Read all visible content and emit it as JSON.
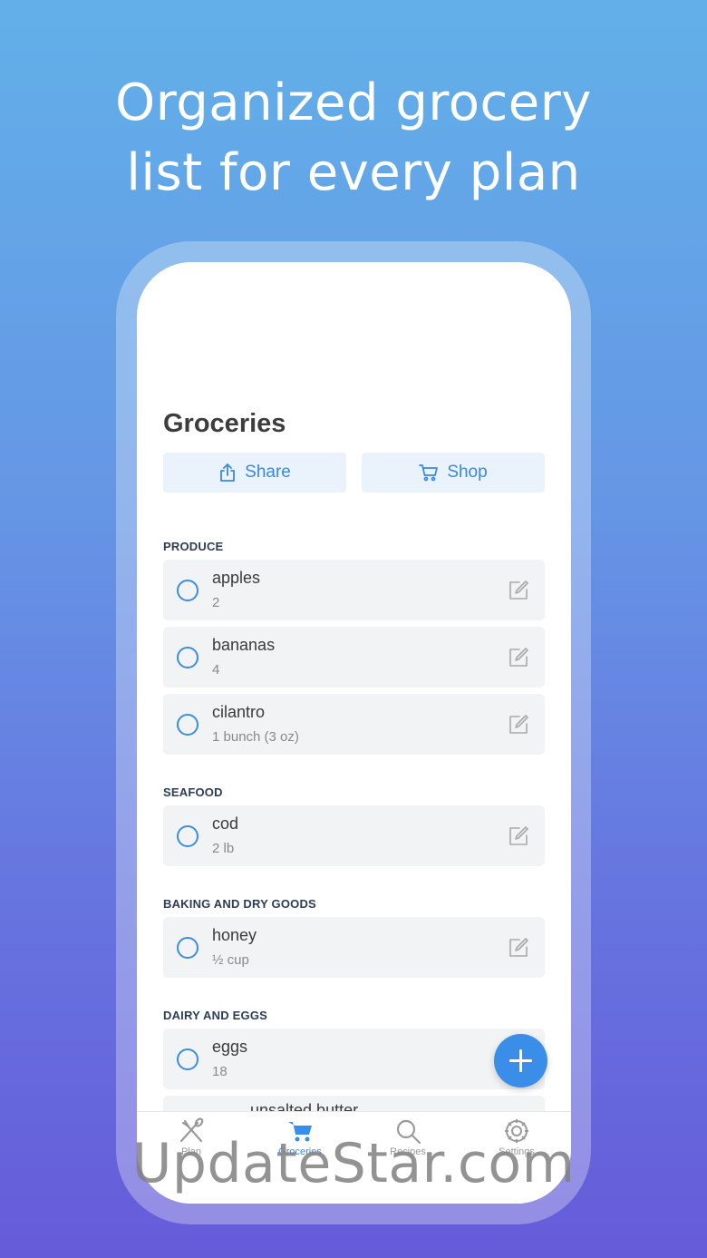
{
  "headline": {
    "line1": "Organized grocery",
    "line2": "list for every plan"
  },
  "screen": {
    "title": "Groceries",
    "actions": {
      "share_label": "Share",
      "shop_label": "Shop",
      "share_icon": "share-icon",
      "shop_icon": "cart-icon"
    },
    "sections": [
      {
        "label": "PRODUCE",
        "items": [
          {
            "name": "apples",
            "qty": "2"
          },
          {
            "name": "bananas",
            "qty": "4"
          },
          {
            "name": "cilantro",
            "qty": "1 bunch (3 oz)"
          }
        ]
      },
      {
        "label": "SEAFOOD",
        "items": [
          {
            "name": "cod",
            "qty": "2 lb"
          }
        ]
      },
      {
        "label": "BAKING AND DRY GOODS",
        "items": [
          {
            "name": "honey",
            "qty": "½ cup"
          }
        ]
      },
      {
        "label": "DAIRY AND EGGS",
        "items": [
          {
            "name": "eggs",
            "qty": "18"
          }
        ]
      }
    ],
    "partial_item_text": "unsalted butter",
    "fab_icon": "plus-icon"
  },
  "tabbar": {
    "tabs": [
      {
        "label": "Plan",
        "icon": "fork-knife-icon",
        "active": false
      },
      {
        "label": "Groceries",
        "icon": "cart-icon",
        "active": true
      },
      {
        "label": "Recipes",
        "icon": "search-icon",
        "active": false
      },
      {
        "label": "Settings",
        "icon": "gear-icon",
        "active": false
      }
    ]
  },
  "watermark": "UpdateStar.com",
  "colors": {
    "accent": "#3a8ee8",
    "background_top": "#62b0e9",
    "background_bottom": "#665bd9",
    "item_bg": "#f2f3f4",
    "section_label": "#2b3e55"
  }
}
